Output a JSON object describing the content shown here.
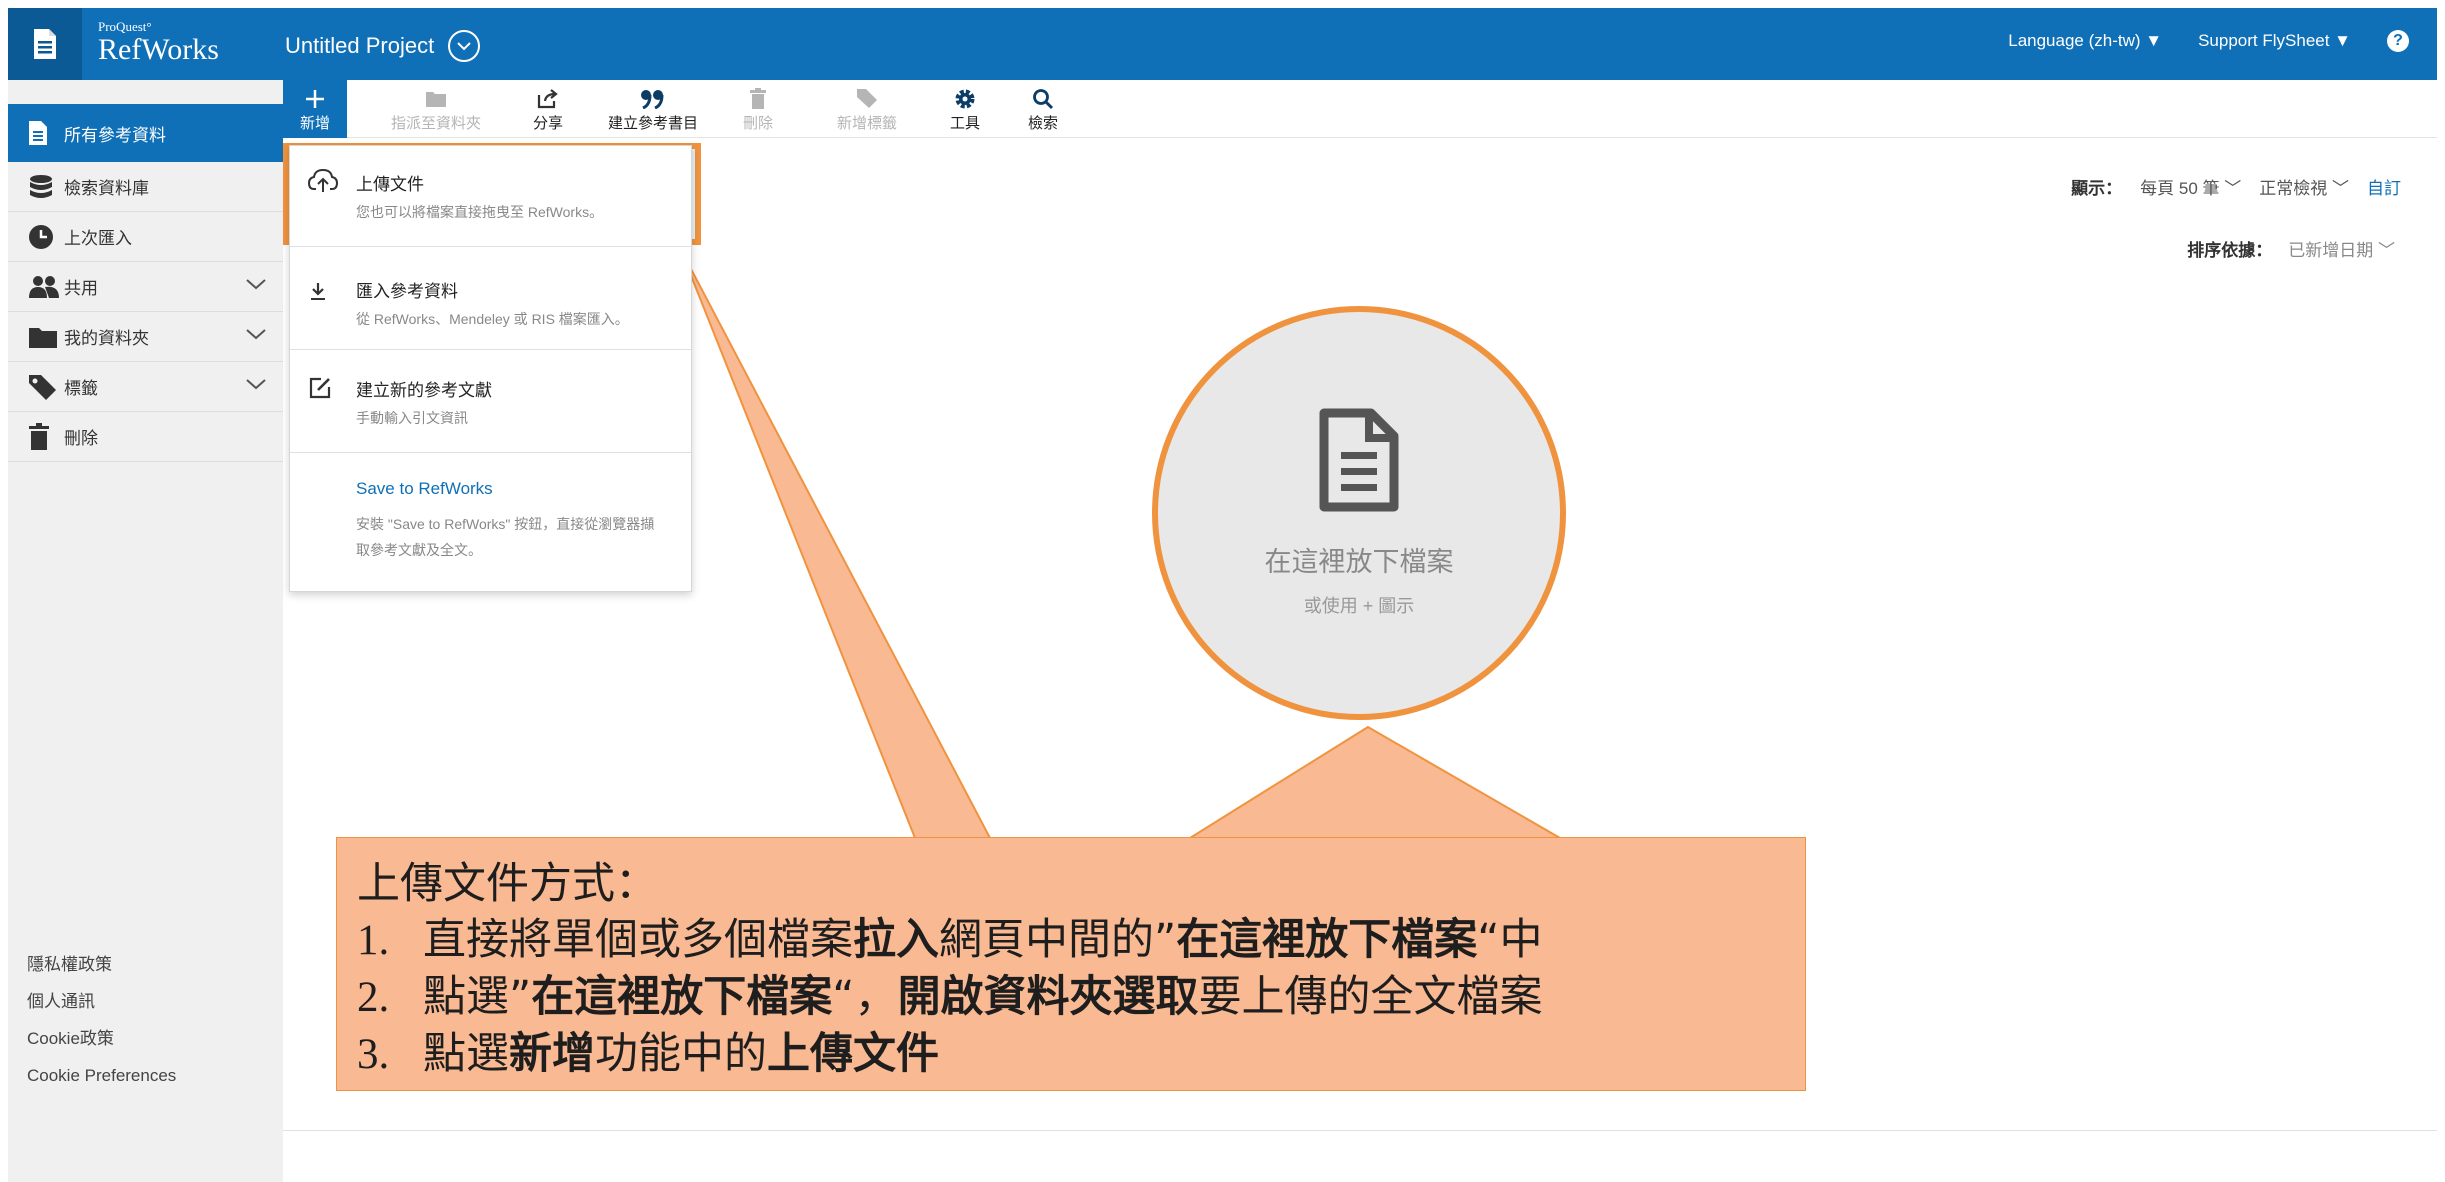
{
  "header": {
    "brand_small": "ProQuest°",
    "brand_name": "RefWorks",
    "project_title": "Untitled Project",
    "language": "Language (zh-tw) ▼",
    "support": "Support FlySheet ▼",
    "help": "?",
    "colors": {
      "bar": "#0f6fb7",
      "accent": "#f0933f"
    }
  },
  "sidebar": {
    "items": [
      {
        "label": "所有參考資料",
        "icon": "document-icon",
        "active": true
      },
      {
        "label": "檢索資料庫",
        "icon": "database-icon"
      },
      {
        "label": "上次匯入",
        "icon": "clock-icon"
      },
      {
        "label": "共用",
        "icon": "users-icon",
        "expandable": true
      },
      {
        "label": "我的資料夾",
        "icon": "folder-icon",
        "expandable": true
      },
      {
        "label": "標籤",
        "icon": "tag-icon",
        "expandable": true
      },
      {
        "label": "刪除",
        "icon": "trash-icon"
      }
    ],
    "footer": [
      "隱私權政策",
      "個人通訊",
      "Cookie政策",
      "Cookie Preferences"
    ]
  },
  "toolbar": {
    "tools": [
      {
        "label": "新增",
        "icon": "plus-icon",
        "state": "active"
      },
      {
        "label": "指派至資料夾",
        "icon": "folder-icon",
        "state": "disabled"
      },
      {
        "label": "分享",
        "icon": "share-icon",
        "state": "enabled"
      },
      {
        "label": "建立參考書目",
        "icon": "quote-icon",
        "state": "enabled"
      },
      {
        "label": "刪除",
        "icon": "trash-icon",
        "state": "disabled"
      },
      {
        "label": "新增標籤",
        "icon": "tag-icon",
        "state": "disabled"
      },
      {
        "label": "工具",
        "icon": "gear-icon",
        "state": "enabled"
      },
      {
        "label": "檢索",
        "icon": "search-icon",
        "state": "enabled"
      }
    ]
  },
  "dropdown": {
    "items": [
      {
        "title": "上傳文件",
        "sub": "您也可以將檔案直接拖曳至 RefWorks。",
        "icon": "cloud-upload-icon"
      },
      {
        "title": "匯入參考資料",
        "sub": "從 RefWorks、Mendeley 或 RIS 檔案匯入。",
        "icon": "download-icon"
      },
      {
        "title": "建立新的參考文獻",
        "sub": "手動輸入引文資訊",
        "icon": "edit-icon"
      },
      {
        "title": "Save to RefWorks",
        "sub1": "安裝 \"Save to RefWorks\" 按鈕，直接從瀏覽器擷",
        "sub2": "取參考文獻及全文。"
      }
    ]
  },
  "view": {
    "display_label": "顯示：",
    "per_page": "每頁 50 筆",
    "view_mode": "正常檢視",
    "custom": "自訂",
    "sort_label": "排序依據：",
    "sort_value": "已新增日期"
  },
  "drop_zone": {
    "title": "在這裡放下檔案",
    "sub": "或使用 + 圖示"
  },
  "callout": {
    "heading": "上傳文件方式：",
    "line1": {
      "num": "1.",
      "a": "直接將單個或多個檔案",
      "b": "拉入",
      "c": "網頁中間的”",
      "d": "在這裡放下檔案",
      "e": "“中"
    },
    "line2": {
      "num": "2.",
      "a": "點選”",
      "b": "在這裡放下檔案",
      "c": "“，",
      "d": "開啟資料夾選取",
      "e": "要上傳的全文檔案"
    },
    "line3": {
      "num": "3.",
      "a": "點選",
      "b": "新增",
      "c": "功能中的",
      "d": "上傳文件"
    }
  }
}
